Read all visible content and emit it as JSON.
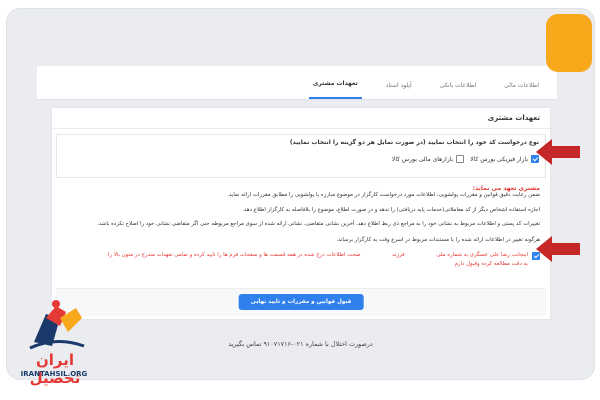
{
  "tabs": [
    {
      "label": "اطلاعات مالی",
      "active": false
    },
    {
      "label": "اطلاعات بانکی",
      "active": false
    },
    {
      "label": "آپلود اسناد",
      "active": false
    },
    {
      "label": "تعهدات مشتری",
      "active": true
    }
  ],
  "panel": {
    "title": "تعهدات مشتری",
    "type_label": "نوع درخواست کد خود را انتخاب نمایید (در صورت تمایل هر دو گزینه را انتخاب نمایید)",
    "options": [
      {
        "label": "بازار فیزیکی بورس کالا",
        "checked": true
      },
      {
        "label": "بازارهای مالی بورس کالا",
        "checked": false
      }
    ],
    "commitment_heading": "مشتری تعهد می نماید:",
    "paragraphs": [
      "ضمن رعایت دقیق قوانین و مقررات پولشویی، اطلاعات مورد درخواست کارگزار در موضوع مبارزه با پولشویی را مطابق مقررات ارائه نماید.",
      "اجازه استفاده اشخاص دیگر از کد معاملاتی(خدمات پایه دریافتی) را ندهد و در صورت اطلاع، موضوع را بلافاصله به کارگزار اطلاع دهد.",
      "تغییرات کد پستی و اطلاعات مربوط به نشانی خود را به مراجع ذی ربط اطلاع دهد. آخرین نشانی متقاضی، نشانی ارائه شده از سوی مراجع مربوطه حتی اگر متقاضی نشانی خود را اصلاح نکرده باشد.",
      "هرگونه تغییر در اطلاعات ارائه شده را با مستندات مربوط در اسرع وقت به کارگزار برساند."
    ],
    "agree": {
      "part1": "اینجانب رضا علی عسگری به شماره ملی",
      "part2": "فرزند",
      "part3": "صحت اطلاعات درج شده در همه قسمت ها و صفحات فرم ها را تایید کرده و تمامی تعهدات مندرج در متون بالا را",
      "line2": "به دقت مطالعه کرده وقبول دارم",
      "checked": true
    },
    "submit_label": "قبول قوانین و مقررات و تایید نهایی"
  },
  "contact_text": "درصورت اختلال با شماره ۰۲۱-۹۱۰۷۱۷۱۶ تماس بگیرید",
  "logo": {
    "name": "ایران تحصیل",
    "site": "IRANTAHSIL.ORG"
  },
  "colors": {
    "accent": "#2f80ed",
    "warning": "#e53935",
    "badge": "#f7a81b",
    "arrow": "#c62828"
  }
}
